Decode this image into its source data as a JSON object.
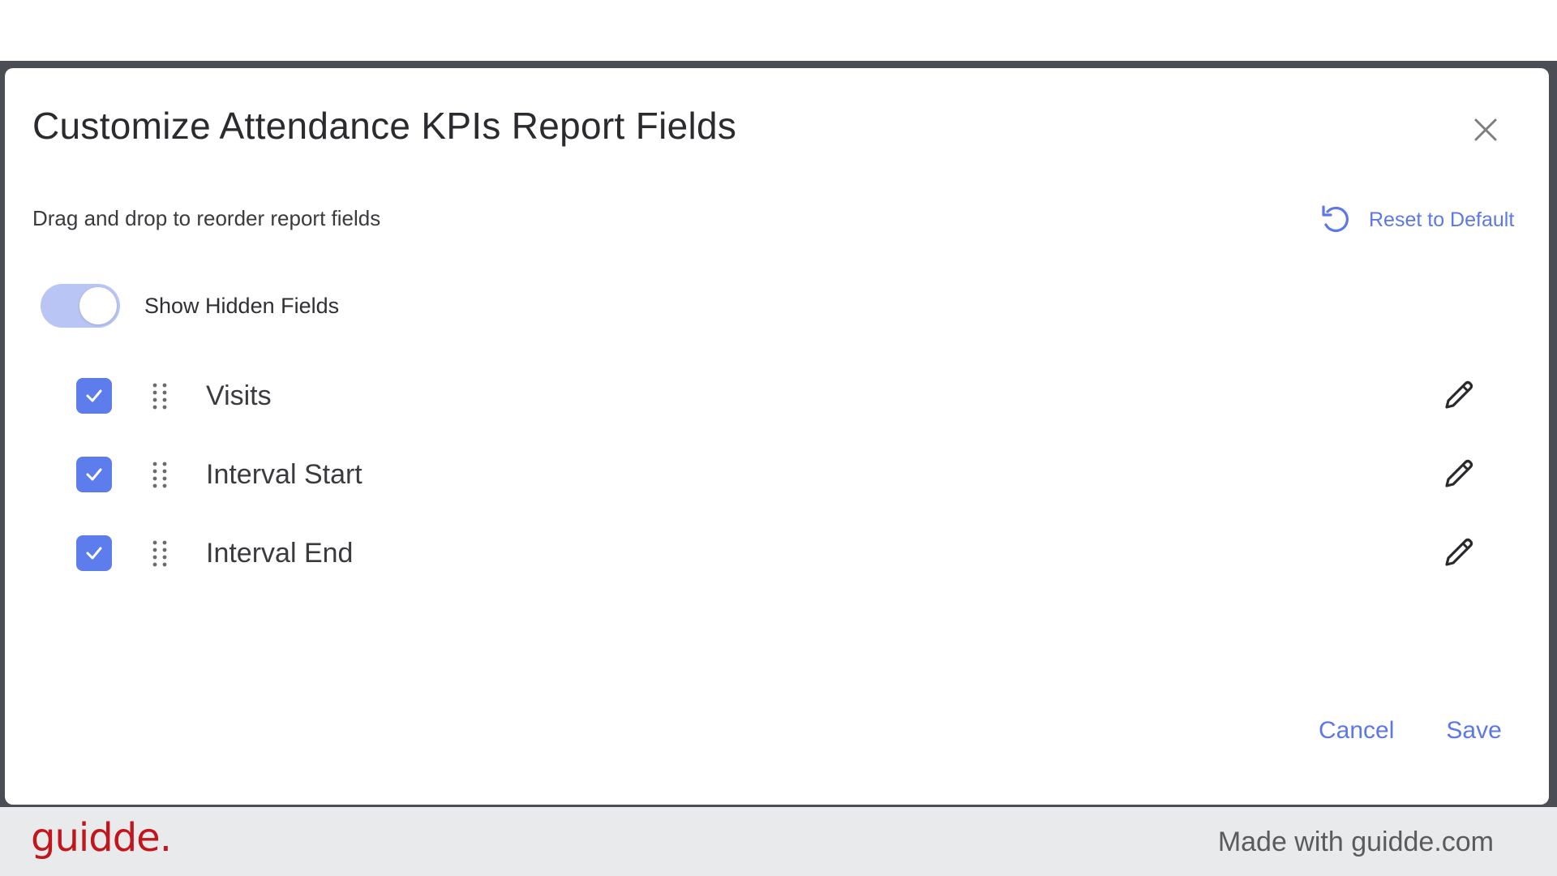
{
  "dialog": {
    "title": "Customize Attendance KPIs Report Fields",
    "subtitle": "Drag and drop to reorder report fields",
    "reset_label": "Reset to Default",
    "toggle": {
      "label": "Show Hidden Fields",
      "on": true
    },
    "fields": [
      {
        "label": "Visits",
        "checked": true
      },
      {
        "label": "Interval Start",
        "checked": true
      },
      {
        "label": "Interval End",
        "checked": true
      }
    ],
    "cancel_label": "Cancel",
    "save_label": "Save"
  },
  "footer": {
    "logo_text": "guidde.",
    "made_with": "Made with guidde.com"
  },
  "colors": {
    "accent": "#5c78e6",
    "checkbox": "#5e7dec",
    "toggle_track": "#b9c6f5",
    "brand": "#c0161c",
    "backdrop": "#4a4d53",
    "footer_bg": "#e9eaec"
  },
  "icons": {
    "close": "close-icon",
    "reset": "reset-icon",
    "drag": "drag-handle-icon",
    "edit": "pencil-icon",
    "check": "check-icon"
  }
}
